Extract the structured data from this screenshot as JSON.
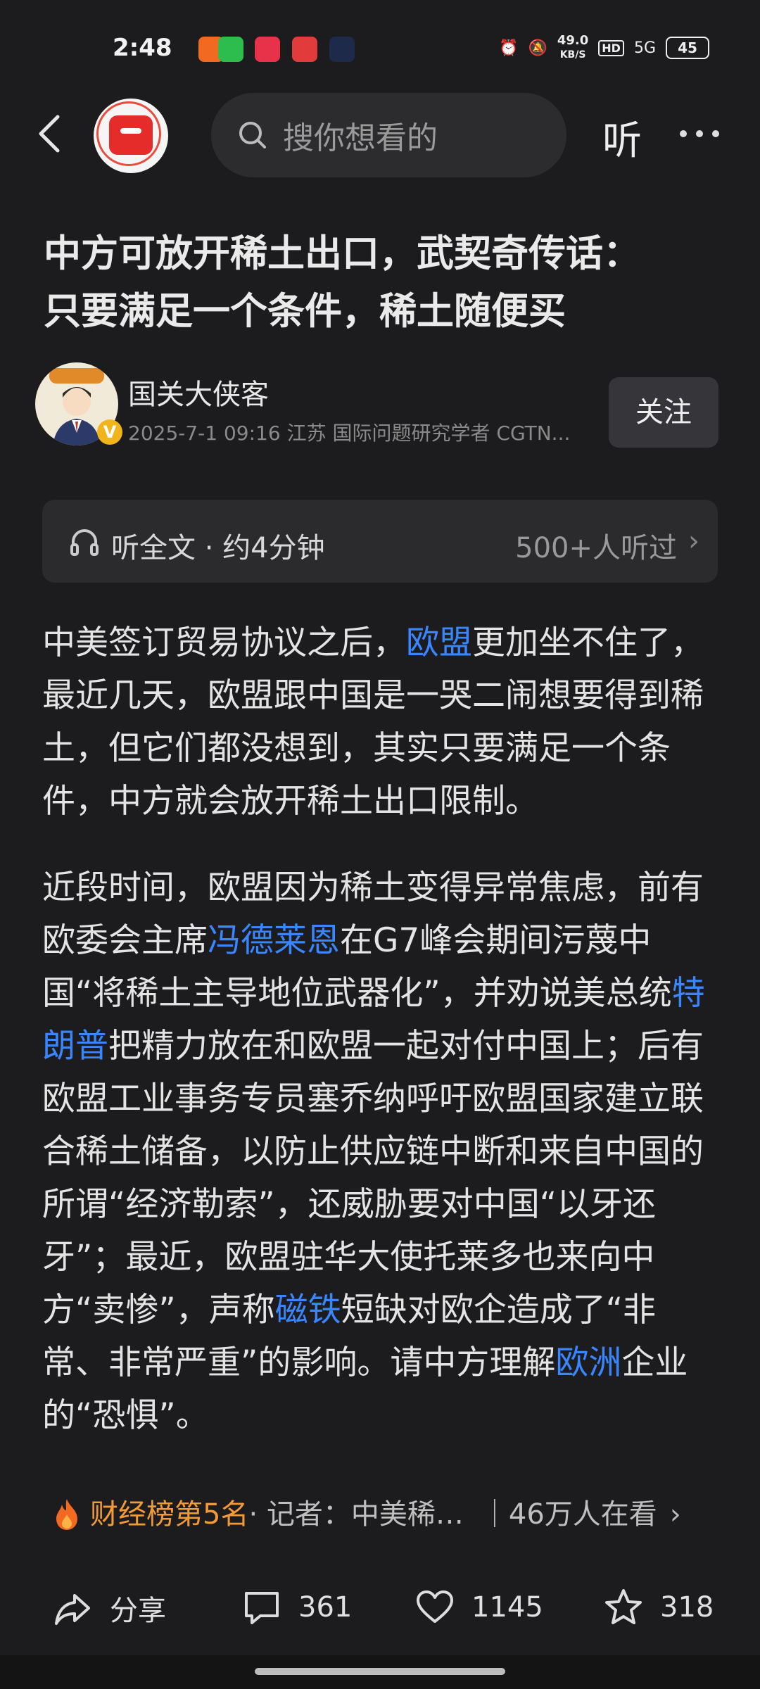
{
  "status": {
    "time": "2:48",
    "net_speed": "49.0",
    "net_unit": "KB/S",
    "hd": "HD",
    "signal": "5G",
    "battery": "45"
  },
  "nav": {
    "search_placeholder": "搜你想看的",
    "listen_label": "听"
  },
  "article": {
    "title_line1": "中方可放开稀土出口，武契奇传话：",
    "title_line2": "只要满足一个条件，稀土随便买",
    "author_name": "国关大侠客",
    "author_meta": "2025-7-1  09:16  江苏  国际问题研究学者 CGTN...",
    "follow_label": "关注",
    "listen_text": "听全文 · 约4分钟",
    "listen_count": "500+人听过",
    "p1_a": "中美签订贸易协议之后，",
    "p1_link": "欧盟",
    "p1_b": "更加坐不住了，最近几天，欧盟跟中国是一哭二闹想要得到稀土，但它们都没想到，其实只要满足一个条件，中方就会放开稀土出口限制。",
    "p2_a": "近段时间，欧盟因为稀土变得异常焦虑，前有欧委会主席",
    "p2_link1": "冯德莱恩",
    "p2_b": "在G7峰会期间污蔑中国“将稀土主导地位武器化”，并劝说美总统",
    "p2_link2": "特朗普",
    "p2_c": "把精力放在和欧盟一起对付中国上；后有欧盟工业事务专员塞乔纳呼吁欧盟国家建立联合稀土储备，以防止供应链中断和来自中国的所谓“经济勒索”，还威胁要对中国“以牙还牙”；最近，欧盟驻华大使托莱多也来向中方“卖惨”，声称",
    "p2_link3": "磁铁",
    "p2_d": "短缺对欧企造成了“非常、非常严重”的影响。请中方理解",
    "p2_link4": "欧洲",
    "p2_e": "企业的“恐惧”。"
  },
  "rank": {
    "label": "财经榜第5名",
    "reporter": " · 记者：中美稀…",
    "viewers": "｜46万人在看"
  },
  "actions": {
    "share": "分享",
    "comments": "361",
    "likes": "1145",
    "stars": "318"
  },
  "colors": {
    "background": "#1c1c1e",
    "link": "#3a86ff",
    "rank": "#f29a38"
  }
}
